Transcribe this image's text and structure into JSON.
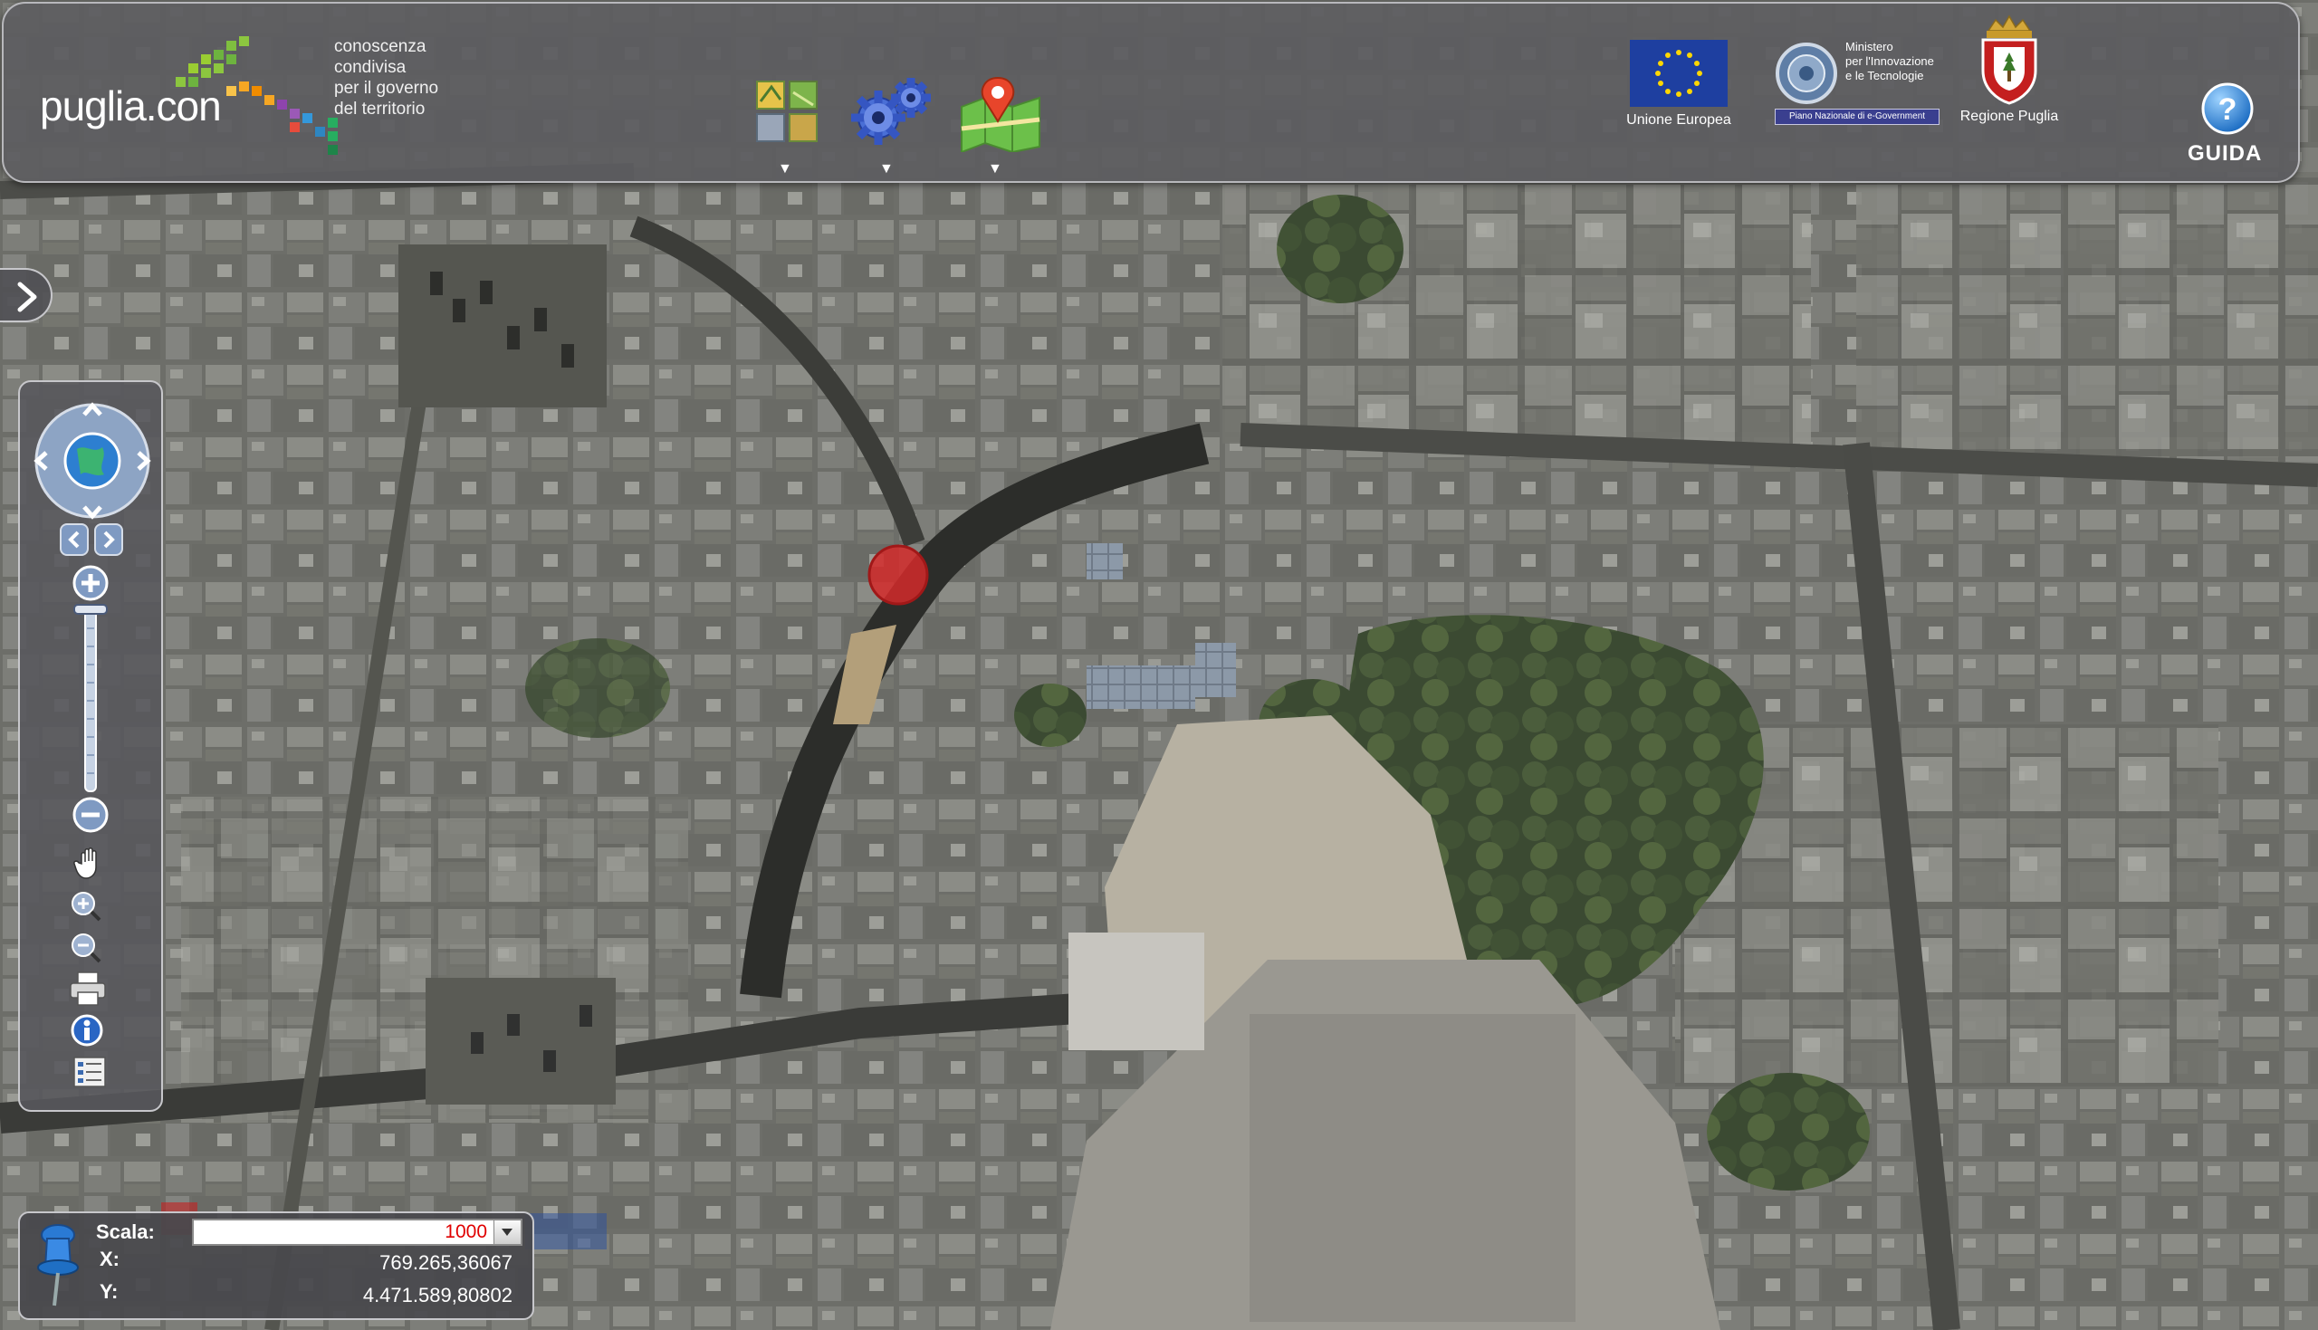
{
  "logo": {
    "name": "puglia.con",
    "tagline": [
      "conoscenza",
      "condivisa",
      "per il governo",
      "del territorio"
    ]
  },
  "toolbar": {
    "tools": [
      {
        "name": "layers-tool",
        "arrow": "▼"
      },
      {
        "name": "settings-tool",
        "arrow": "▼"
      },
      {
        "name": "map-tool",
        "arrow": "▼"
      }
    ]
  },
  "partners": {
    "eu": "Unione Europea",
    "ministero": [
      "Ministero",
      "per l'Innovazione",
      "e le Tecnologie"
    ],
    "ministero_banner": "Piano Nazionale di e-Government",
    "regione": "Regione Puglia"
  },
  "help": {
    "label": "GUIDA",
    "glyph": "?"
  },
  "info": {
    "scale_label": "Scala:",
    "scale_value": "1000",
    "x_label": "X:",
    "x_value": "769.265,36067",
    "y_label": "Y:",
    "y_value": "4.471.589,80802"
  },
  "colors": {
    "panel": "#5c5c60",
    "marker": "#d42a2a",
    "eu_blue": "#1e3fa0",
    "eu_star": "#ffd700",
    "scale_text": "#e00000"
  }
}
